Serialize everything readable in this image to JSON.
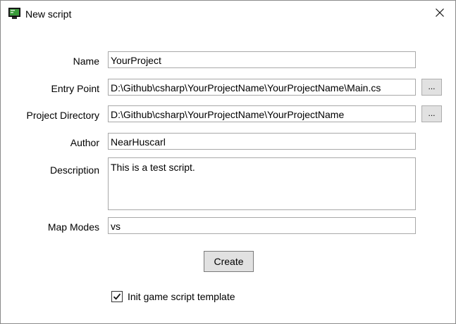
{
  "window": {
    "title": "New script",
    "close_label": "Close"
  },
  "form": {
    "name": {
      "label": "Name",
      "value": "YourProject"
    },
    "entry_point": {
      "label": "Entry Point",
      "value": "D:\\Github\\csharp\\YourProjectName\\YourProjectName\\Main.cs"
    },
    "project_dir": {
      "label": "Project Directory",
      "value": "D:\\Github\\csharp\\YourProjectName\\YourProjectName"
    },
    "author": {
      "label": "Author",
      "value": "NearHuscarl"
    },
    "description": {
      "label": "Description",
      "value": "This is a test script."
    },
    "map_modes": {
      "label": "Map Modes",
      "value": "vs"
    }
  },
  "buttons": {
    "browse": "...",
    "create": "Create"
  },
  "options": {
    "init_template": {
      "label": "Init game script template",
      "checked": true
    }
  },
  "icons": {
    "app": "terminal-window-icon",
    "close": "close-icon",
    "check": "checkmark-icon"
  }
}
